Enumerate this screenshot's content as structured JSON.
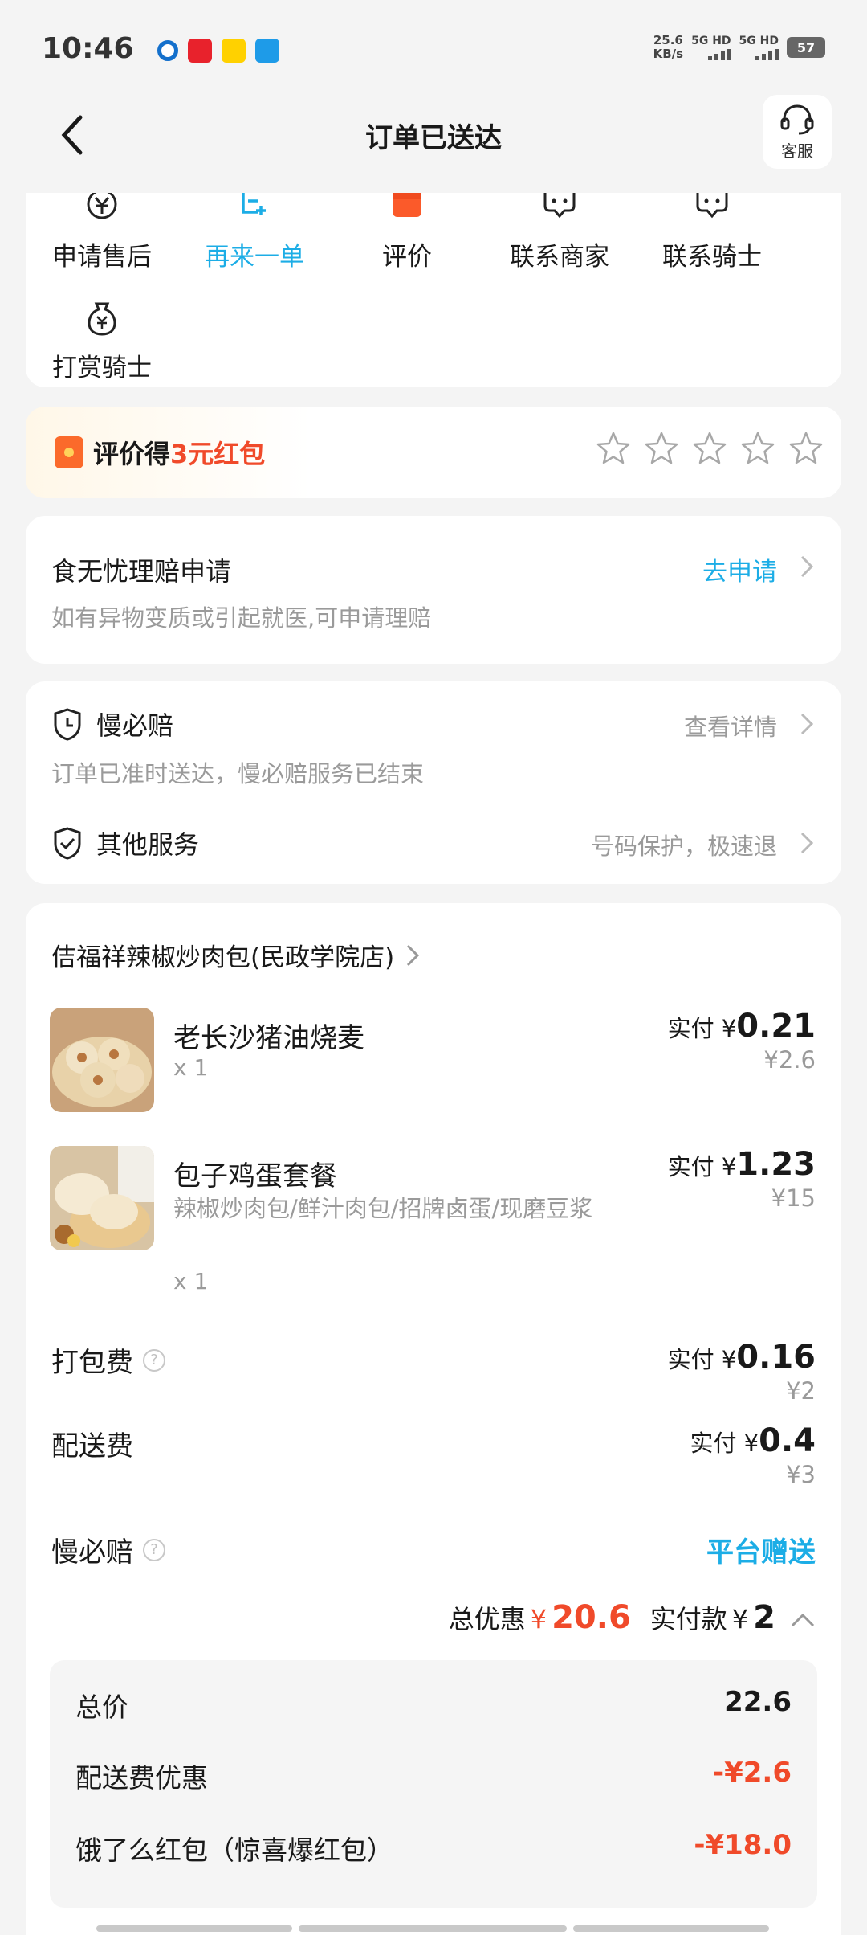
{
  "status_bar": {
    "time": "10:46",
    "net_speed_value": "25.6",
    "net_speed_unit": "KB/s",
    "sim1": "5G HD",
    "sim2": "5G HD",
    "battery": "57"
  },
  "header": {
    "title": "订单已送达",
    "customer_service_label": "客服"
  },
  "actions": [
    {
      "label": "申请售后",
      "icon": "yuan-refund-icon"
    },
    {
      "label": "再来一单",
      "icon": "reorder-icon"
    },
    {
      "label": "评价",
      "icon": "red-packet-icon"
    },
    {
      "label": "联系商家",
      "icon": "chat-icon"
    },
    {
      "label": "联系骑士",
      "icon": "chat-icon"
    },
    {
      "label": "打赏骑士",
      "icon": "money-bag-icon"
    }
  ],
  "rating": {
    "prefix": "评价得",
    "highlight": "3元红包",
    "stars": 0
  },
  "claim": {
    "title": "食无忧理赔申请",
    "subtitle": "如有异物变质或引起就医,可申请理赔",
    "link": "去申请"
  },
  "services": {
    "slow_title": "慢必赔",
    "slow_sub": "订单已准时送达，慢必赔服务已结束",
    "slow_link": "查看详情",
    "other_title": "其他服务",
    "other_link": "号码保护，极速退"
  },
  "order": {
    "store": "佶福祥辣椒炒肉包(民政学院店)",
    "paid_prefix": "实付 ¥",
    "items": [
      {
        "name": "老长沙猪油烧麦",
        "sub": "",
        "qty": "x 1",
        "paid": "0.21",
        "orig": "¥2.6"
      },
      {
        "name": "包子鸡蛋套餐",
        "sub": "辣椒炒肉包/鲜汁肉包/招牌卤蛋/现磨豆浆",
        "qty": "x 1",
        "paid": "1.23",
        "orig": "¥15"
      }
    ],
    "packing_label": "打包费",
    "packing_paid": "0.16",
    "packing_orig": "¥2",
    "delivery_label": "配送费",
    "delivery_paid": "0.4",
    "delivery_orig": "¥3",
    "slow_label": "慢必赔",
    "slow_value": "平台赠送",
    "discount_label": "总优惠",
    "discount_currency": "¥",
    "discount_value": "20.6",
    "actual_label": "实付款",
    "actual_currency": "¥",
    "actual_value": "2"
  },
  "breakdown": {
    "total_label": "总价",
    "total_value": "22.6",
    "delivery_discount_label": "配送费优惠",
    "delivery_discount_value": "-¥2.6",
    "redpacket_label": "饿了么红包（惊喜爆红包）",
    "redpacket_value": "-¥18.0"
  },
  "colors": {
    "accent_blue": "#1cade6",
    "accent_red": "#f04a2a"
  }
}
